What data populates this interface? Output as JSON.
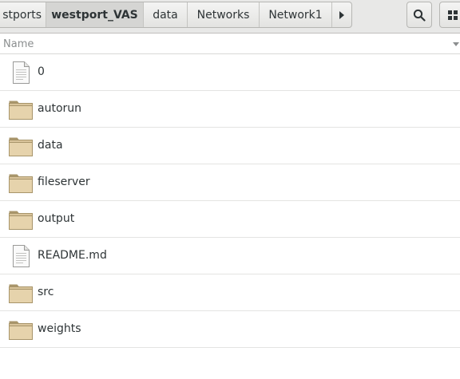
{
  "pathbar": {
    "crumbs": [
      "stports",
      "westport_VAS",
      "data",
      "Networks",
      "Network1"
    ]
  },
  "toolbar": {
    "search_icon": "search-icon",
    "view_icon": "grid-view-icon"
  },
  "columns": {
    "name": "Name"
  },
  "files": [
    {
      "name": "0",
      "kind": "file"
    },
    {
      "name": "autorun",
      "kind": "folder"
    },
    {
      "name": "data",
      "kind": "folder"
    },
    {
      "name": "fileserver",
      "kind": "folder"
    },
    {
      "name": "output",
      "kind": "folder"
    },
    {
      "name": "README.md",
      "kind": "file"
    },
    {
      "name": "src",
      "kind": "folder"
    },
    {
      "name": "weights",
      "kind": "folder"
    }
  ],
  "colors": {
    "folder_fill": "#e6d3ac",
    "folder_edge": "#a8956a",
    "text": "#2e3436"
  }
}
